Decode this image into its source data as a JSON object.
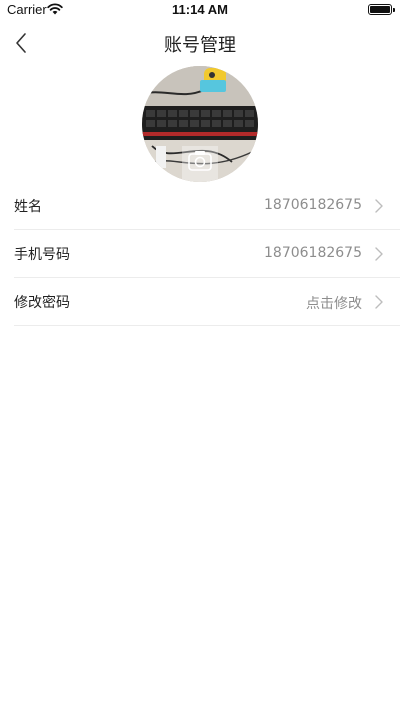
{
  "status_bar": {
    "carrier": "Carrier",
    "time": "11:14 AM"
  },
  "nav": {
    "title": "账号管理"
  },
  "rows": [
    {
      "label": "姓名",
      "value": "18706182675"
    },
    {
      "label": "手机号码",
      "value": "18706182675"
    },
    {
      "label": "修改密码",
      "value": "点击修改"
    }
  ],
  "icons": {
    "back": "chevron-left-icon",
    "wifi": "wifi-icon",
    "battery": "battery-icon",
    "row_chevron": "chevron-right-icon",
    "camera": "camera-icon"
  },
  "colors": {
    "text": "#222222",
    "secondary": "#8d8d8d",
    "divider": "#ececec"
  }
}
